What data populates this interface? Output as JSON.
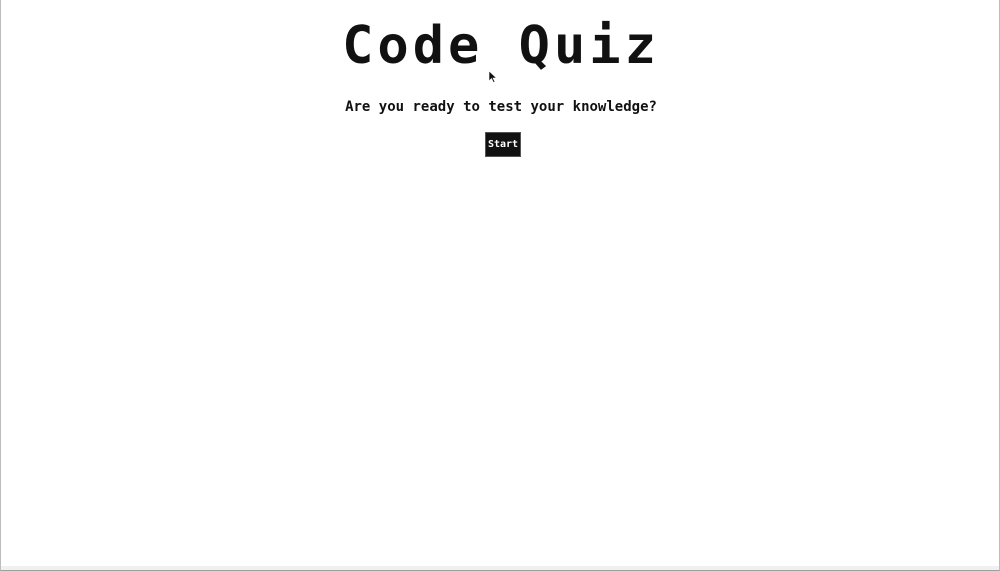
{
  "page": {
    "title": "Code Quiz",
    "subtitle": "Are you ready to test your knowledge?",
    "start_label": "Start"
  },
  "icons": {
    "cursor": "mouse-pointer-icon"
  },
  "colors": {
    "text": "#111111",
    "button_bg": "#111111",
    "button_text": "#ffffff",
    "background": "#ffffff"
  }
}
